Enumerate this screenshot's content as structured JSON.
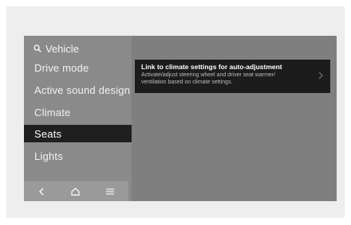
{
  "sidebar": {
    "header": {
      "label": "Vehicle",
      "icon": "search-icon"
    },
    "items": [
      {
        "label": "Drive mode",
        "selected": false
      },
      {
        "label": "Active sound design",
        "selected": false
      },
      {
        "label": "Climate",
        "selected": false
      },
      {
        "label": "Seats",
        "selected": true
      },
      {
        "label": "Lights",
        "selected": false
      }
    ]
  },
  "bottom_bar": {
    "icons": [
      "back-icon",
      "home-icon",
      "menu-icon"
    ]
  },
  "content": {
    "setting": {
      "title": "Link to climate settings for auto-adjustment",
      "description_line1": "Activate/adjust steering wheel and driver seat warmer/",
      "description_line2": "ventilation based on climate settings.",
      "icon": "chevron-right-icon"
    }
  },
  "colors": {
    "screen_bg": "#7f7f7f",
    "sidebar_bg": "#8a8a8a",
    "selected_bg": "#1f1f1f",
    "card_bg": "#1c1c1c"
  }
}
